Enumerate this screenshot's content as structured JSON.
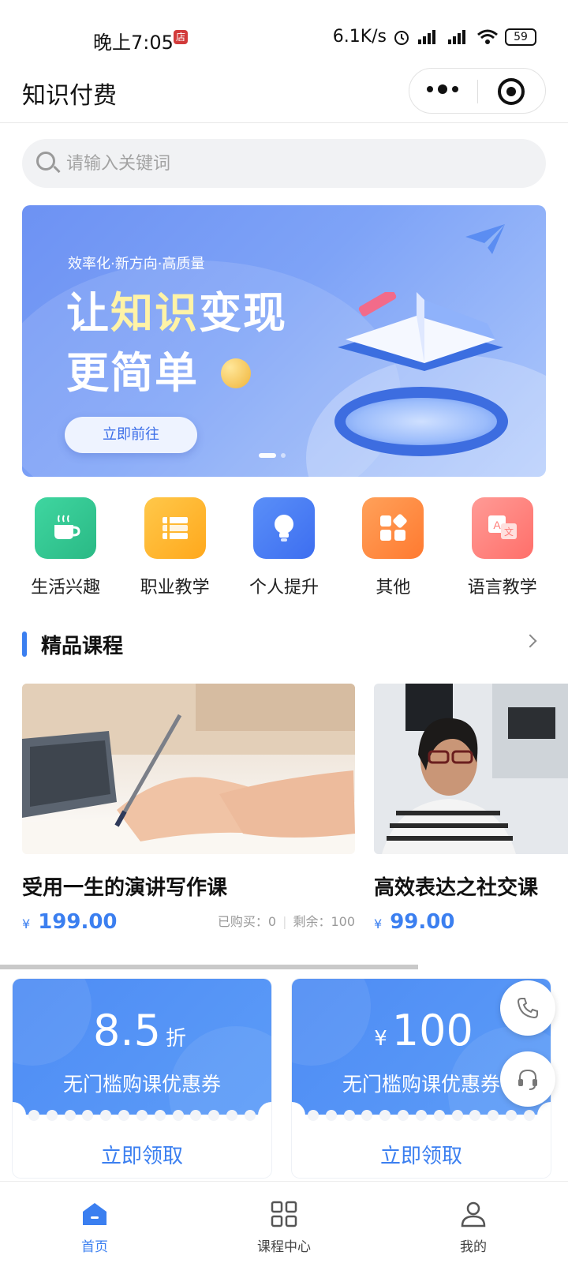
{
  "status_bar": {
    "time": "晚上7:05",
    "network_speed": "6.1K/s",
    "battery": "59"
  },
  "nav": {
    "title": "知识付费"
  },
  "search": {
    "placeholder": "请输入关键词"
  },
  "banner": {
    "subtitle": "效率化·新方向·高质量",
    "headline_part1": "让",
    "headline_highlight": "知识",
    "headline_part2": "变现",
    "headline_line2": "更简单",
    "button_label": "立即前往"
  },
  "categories": [
    {
      "label": "生活兴趣",
      "color": "#2fc38e",
      "icon": "coffee-icon"
    },
    {
      "label": "职业教学",
      "color": "#ffb629",
      "icon": "books-icon"
    },
    {
      "label": "个人提升",
      "color": "#3d78f2",
      "icon": "lightbulb-icon"
    },
    {
      "label": "其他",
      "color": "#ff8a3c",
      "icon": "grid-icon"
    },
    {
      "label": "语言教学",
      "color": "#ff7c78",
      "icon": "translate-icon"
    }
  ],
  "section": {
    "title": "精品课程"
  },
  "courses": [
    {
      "title": "受用一生的演讲写作课",
      "currency": "¥",
      "price": "199.00",
      "purchased": "已购买：0",
      "remaining": "剩余：100"
    },
    {
      "title": "高效表达之社交课",
      "currency": "¥",
      "price": "99.00"
    }
  ],
  "coupons": [
    {
      "value": "8.5",
      "unit": "折",
      "description": "无门槛购课优惠券",
      "action": "立即领取"
    },
    {
      "currency": "¥",
      "value": "100",
      "description": "无门槛购课优惠券",
      "action": "立即领取"
    }
  ],
  "tabbar": [
    {
      "label": "首页",
      "icon": "home-icon",
      "active": true
    },
    {
      "label": "课程中心",
      "icon": "grid-icon",
      "active": false
    },
    {
      "label": "我的",
      "icon": "user-icon",
      "active": false
    }
  ],
  "colors": {
    "accent": "#3b7ff0",
    "coupon_bg": "#4e8cf4"
  }
}
